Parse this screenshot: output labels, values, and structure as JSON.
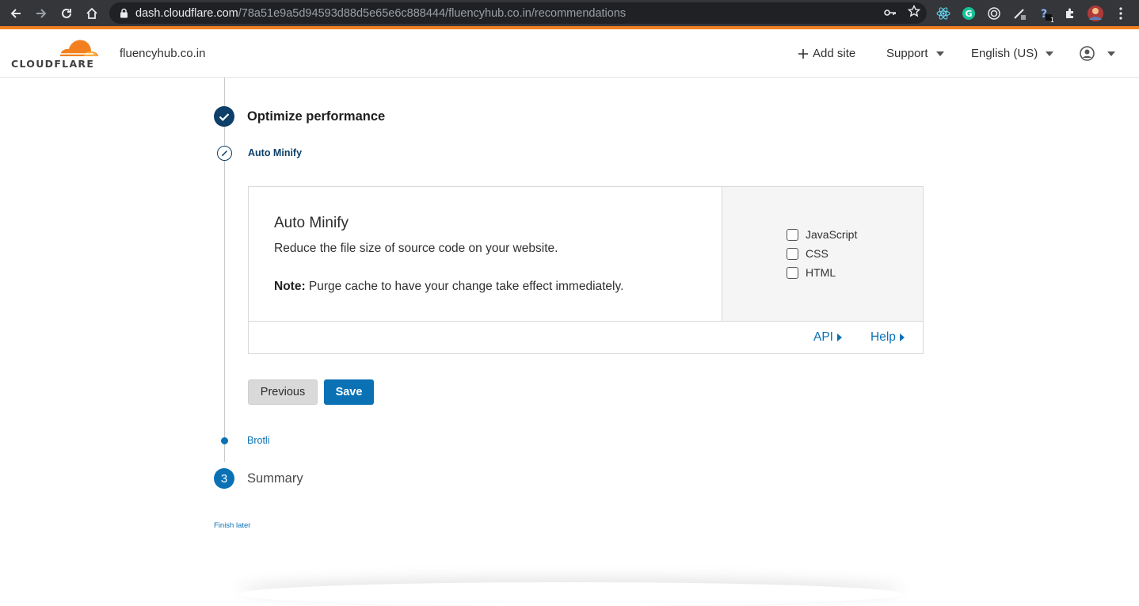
{
  "browser": {
    "url_host": "dash.cloudflare.com",
    "url_path": "/78a51e9a5d94593d88d5e65e6c888444/fluencyhub.co.in/recommendations",
    "extension_badge": "1"
  },
  "header": {
    "logo_text": "CLOUDFLARE",
    "site": "fluencyhub.co.in",
    "add_site": "Add site",
    "support": "Support",
    "language": "English (US)"
  },
  "wizard": {
    "step_title": "Optimize performance",
    "current_sub_step": "Auto Minify",
    "card": {
      "title": "Auto Minify",
      "description": "Reduce the file size of source code on your website.",
      "note_label": "Note:",
      "note_text": " Purge cache to have your change take effect immediately.",
      "options": [
        {
          "label": "JavaScript",
          "checked": false
        },
        {
          "label": "CSS",
          "checked": false
        },
        {
          "label": "HTML",
          "checked": false
        }
      ],
      "api_link": "API",
      "help_link": "Help"
    },
    "previous_button": "Previous",
    "save_button": "Save",
    "next_sub_step": "Brotli",
    "next_step_number": "3",
    "next_step_title": "Summary",
    "finish_later": "Finish later"
  },
  "colors": {
    "accent_orange": "#f38020",
    "primary_blue": "#0a71b5",
    "dark_navy": "#0d3f68"
  }
}
